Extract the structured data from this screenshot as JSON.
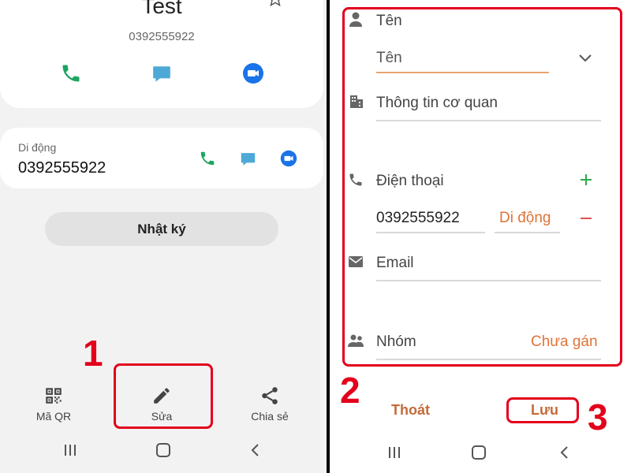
{
  "left": {
    "contact": {
      "name": "Test",
      "number": "0392555922"
    },
    "mobile": {
      "label": "Di động",
      "number": "0392555922"
    },
    "log_button": "Nhật ký",
    "bottom_actions": {
      "qr_label": "Mã QR",
      "edit_label": "Sửa",
      "share_label": "Chia sẻ"
    },
    "step_number": "1"
  },
  "right": {
    "fields": {
      "name_section_label": "Tên",
      "name_input": "Tên",
      "organization": "Thông tin cơ quan",
      "phone_section_label": "Điện thoại",
      "phone_number": "0392555922",
      "phone_type": "Di động",
      "email": "Email",
      "group_label": "Nhóm",
      "group_value": "Chưa gán"
    },
    "footer": {
      "cancel_label": "Thoát",
      "save_label": "Lưu"
    },
    "step_numbers": {
      "form": "2",
      "save": "3"
    }
  },
  "colors": {
    "highlight": "#e3001b",
    "call_green": "#1fa463",
    "message_teal": "#4fa9d6",
    "video_blue": "#1a73e8",
    "accent_orange": "#e0733a",
    "add_green": "#2eaa4b",
    "remove_red": "#e05252"
  },
  "icons": [
    "star-icon",
    "phone-icon",
    "message-icon",
    "video-call-icon",
    "qr-code-icon",
    "pencil-icon",
    "share-icon",
    "recent-apps-icon",
    "home-icon",
    "back-icon",
    "person-icon",
    "building-icon",
    "email-icon",
    "group-icon",
    "chevron-down-icon",
    "plus-icon",
    "minus-icon"
  ]
}
